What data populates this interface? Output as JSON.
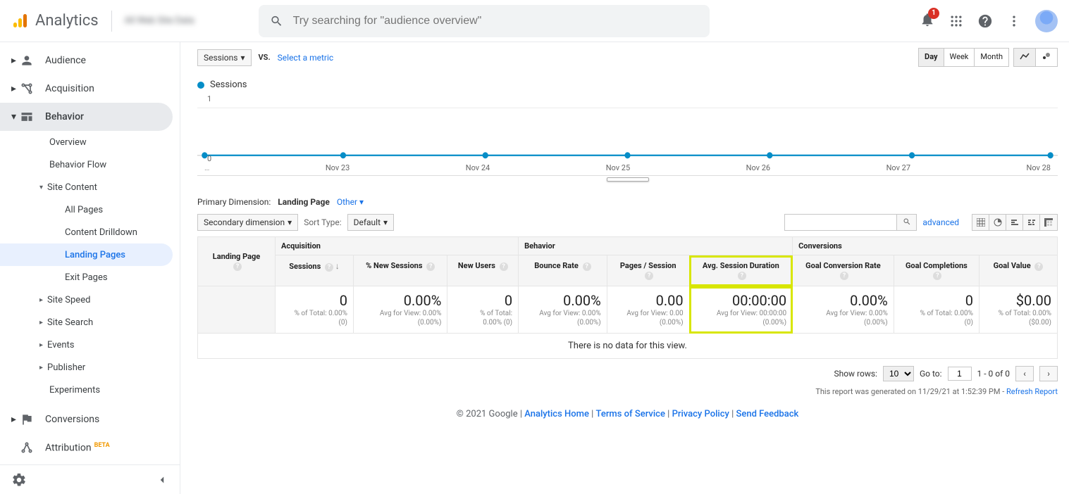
{
  "header": {
    "product": "Analytics",
    "search_placeholder": "Try searching for \"audience overview\"",
    "notification_count": "1"
  },
  "sidebar": {
    "items": {
      "audience": "Audience",
      "acquisition": "Acquisition",
      "behavior": "Behavior",
      "overview": "Overview",
      "behavior_flow": "Behavior Flow",
      "site_content": "Site Content",
      "all_pages": "All Pages",
      "content_drilldown": "Content Drilldown",
      "landing_pages": "Landing Pages",
      "exit_pages": "Exit Pages",
      "site_speed": "Site Speed",
      "site_search": "Site Search",
      "events": "Events",
      "publisher": "Publisher",
      "experiments": "Experiments",
      "conversions": "Conversions",
      "attribution": "Attribution",
      "beta": "BETA"
    }
  },
  "chart_controls": {
    "metric_selector": "Sessions",
    "vs": "VS.",
    "select_metric": "Select a metric",
    "granularity": {
      "day": "Day",
      "week": "Week",
      "month": "Month"
    },
    "legend": "Sessions"
  },
  "chart_data": {
    "type": "line",
    "title": "Sessions",
    "ylabel": "",
    "ylim": [
      0,
      1
    ],
    "y_ticks": [
      "1",
      "0"
    ],
    "categories": [
      "…",
      "Nov 23",
      "Nov 24",
      "Nov 25",
      "Nov 26",
      "Nov 27",
      "Nov 28"
    ],
    "series": [
      {
        "name": "Sessions",
        "values": [
          0,
          0,
          0,
          0,
          0,
          0,
          0
        ]
      }
    ]
  },
  "dimension": {
    "label": "Primary Dimension:",
    "active": "Landing Page",
    "other": "Other"
  },
  "secondary": {
    "secondary_dimension": "Secondary dimension",
    "sort_type_label": "Sort Type:",
    "sort_type_value": "Default",
    "advanced": "advanced"
  },
  "table": {
    "landing_page": "Landing Page",
    "groups": {
      "acq": "Acquisition",
      "beh": "Behavior",
      "conv": "Conversions"
    },
    "cols": {
      "sessions": "Sessions",
      "new_sessions": "% New Sessions",
      "new_users": "New Users",
      "bounce": "Bounce Rate",
      "pps": "Pages / Session",
      "asd": "Avg. Session Duration",
      "gcr": "Goal Conversion Rate",
      "gcomp": "Goal Completions",
      "gval": "Goal Value"
    },
    "totals": {
      "sessions": {
        "v": "0",
        "s1": "% of Total: 0.00%",
        "s2": "(0)"
      },
      "new_sessions": {
        "v": "0.00%",
        "s1": "Avg for View: 0.00%",
        "s2": "(0.00%)"
      },
      "new_users": {
        "v": "0",
        "s1": "% of Total:",
        "s2": "0.00% (0)"
      },
      "bounce": {
        "v": "0.00%",
        "s1": "Avg for View: 0.00%",
        "s2": "(0.00%)"
      },
      "pps": {
        "v": "0.00",
        "s1": "Avg for View: 0.00",
        "s2": "(0.00%)"
      },
      "asd": {
        "v": "00:00:00",
        "s1": "Avg for View: 00:00:00",
        "s2": "(0.00%)"
      },
      "gcr": {
        "v": "0.00%",
        "s1": "Avg for View: 0.00%",
        "s2": "(0.00%)"
      },
      "gcomp": {
        "v": "0",
        "s1": "% of Total: 0.00%",
        "s2": "(0)"
      },
      "gval": {
        "v": "$0.00",
        "s1": "% of Total: 0.00%",
        "s2": "($0.00)"
      }
    },
    "no_data": "There is no data for this view."
  },
  "pager": {
    "show_rows": "Show rows:",
    "rows_value": "10",
    "goto": "Go to:",
    "goto_value": "1",
    "range": "1 - 0 of 0"
  },
  "generated": {
    "text": "This report was generated on 11/29/21 at 1:52:39 PM - ",
    "refresh": "Refresh Report"
  },
  "footer": {
    "copyright": "© 2021 Google",
    "links": {
      "home": "Analytics Home",
      "tos": "Terms of Service",
      "privacy": "Privacy Policy",
      "feedback": "Send Feedback"
    }
  }
}
